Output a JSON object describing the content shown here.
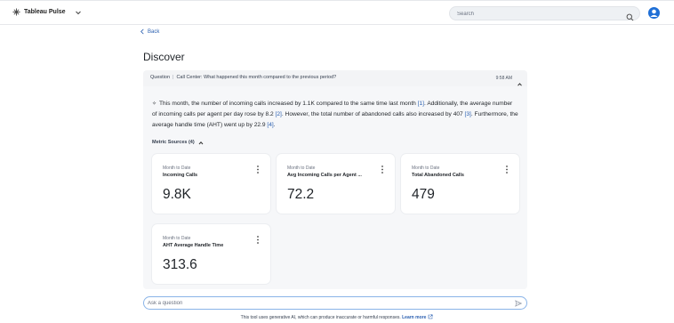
{
  "app": {
    "name": "Tableau Pulse",
    "logo_icon": "tableau-logo-icon",
    "menu_icon": "chevron-down-icon"
  },
  "search": {
    "placeholder": "Search",
    "icon": "search-icon"
  },
  "user": {
    "icon": "user-avatar-icon",
    "color": "#1f6fd6"
  },
  "nav": {
    "back_label": "Back"
  },
  "page": {
    "title": "Discover"
  },
  "question": {
    "tag": "Question",
    "text": "Call Center: What happened this month compared to the previous period?",
    "time": "9:58 AM",
    "collapse_icon": "chevron-up-icon"
  },
  "answer": {
    "spark_icon": "sparkle-icon",
    "part1": "This month, the number of incoming calls increased by 1.1K compared to the same time last month ",
    "ref1": "[1]",
    "part2": ". Additionally, the average number of incoming calls per agent per day rose by 8.2 ",
    "ref2": "[2]",
    "part3": ". However, the total number of abandoned calls also increased by 407 ",
    "ref3": "[3]",
    "part4": ". Furthermore, the average handle time (AHT) went up by 22.9 ",
    "ref4": "[4]",
    "part5": "."
  },
  "metric_sources": {
    "label": "Metric Sources (4)",
    "toggle_icon": "chevron-up-icon"
  },
  "metrics": [
    {
      "period": "Month to Date",
      "name": "Incoming Calls",
      "value": "9.8K"
    },
    {
      "period": "Month to Date",
      "name": "Avg Incoming Calls per Agent ...",
      "value": "72.2"
    },
    {
      "period": "Month to Date",
      "name": "Total Abandoned Calls",
      "value": "479"
    },
    {
      "period": "Month to Date",
      "name": "AHT Average Handle Time",
      "value": "313.6"
    }
  ],
  "ask": {
    "placeholder": "Ask a question",
    "send_icon": "send-icon"
  },
  "disclaimer": {
    "text": "This tool uses generative AI, which can produce inaccurate or harmful responses. ",
    "link": "Learn more",
    "link_icon": "external-link-icon"
  },
  "colors": {
    "link": "#2a5fb0",
    "panel": "#f6f7f9",
    "question_bar": "#f3f4f6",
    "ask_border": "#8ab4e8"
  }
}
